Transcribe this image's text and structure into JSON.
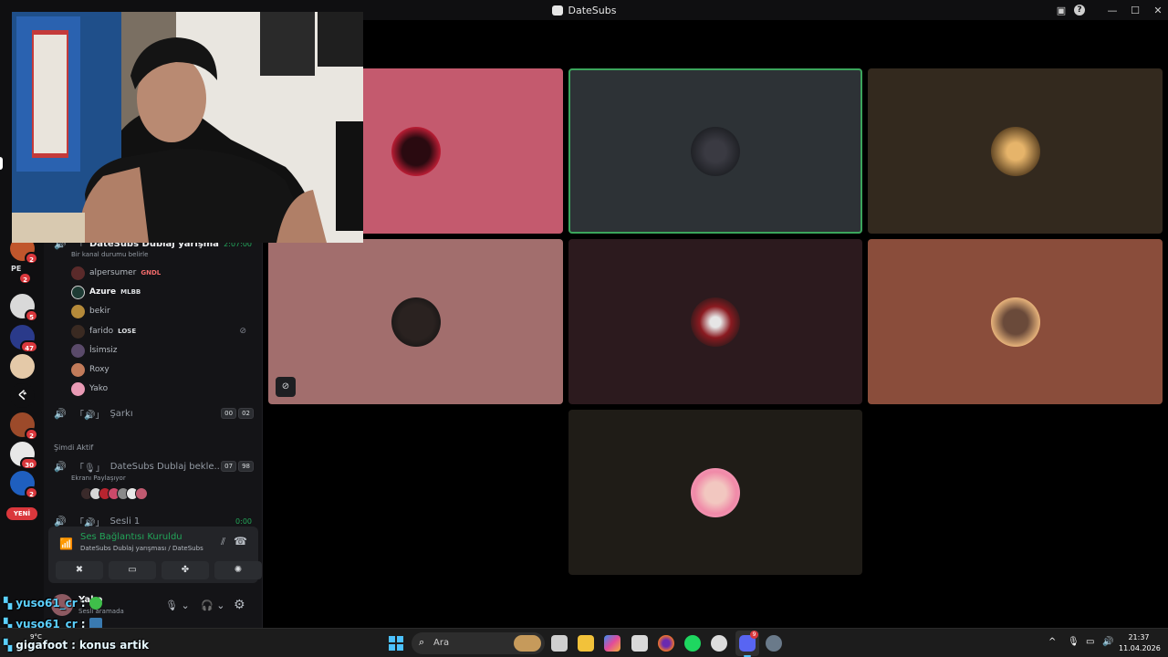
{
  "window": {
    "title": "DateSubs"
  },
  "rail": {
    "pe_label": "PE",
    "badges": [
      "2",
      "2",
      "5",
      "47",
      "2",
      "30",
      "2"
    ],
    "new_label": "YENİ"
  },
  "channels": {
    "top_voice": {
      "name": "DateSubs Dublaj yarışma",
      "timer": "2:07:00",
      "status_prompt": "Bir kanal durumu belirle"
    },
    "members": [
      {
        "name": "alpersumer",
        "tag": "GNDL"
      },
      {
        "name": "Azure",
        "tag": "MLBB"
      },
      {
        "name": "bekir",
        "tag": ""
      },
      {
        "name": "farido",
        "tag": "LOSE"
      },
      {
        "name": "İsimsiz",
        "tag": ""
      },
      {
        "name": "Roxy",
        "tag": ""
      },
      {
        "name": "Yako",
        "tag": ""
      }
    ],
    "sarki": {
      "name": "Şarkı",
      "count_a": "00",
      "count_b": "02"
    },
    "section_active": "Şimdi Aktif",
    "dublaj_bekle": {
      "name": "DateSubs Dublaj bekle...",
      "count_a": "07",
      "count_b": "98",
      "status": "Ekranı Paylaşıyor"
    },
    "sesli1": {
      "name": "Sesli 1",
      "timer": "0:00"
    }
  },
  "voice_panel": {
    "status": "Ses Bağlantısı Kuruldu",
    "channel": "DateSubs Dublaj yarışması / DateSubs"
  },
  "user_bar": {
    "name": "Yako",
    "status": "Sesli aramada"
  },
  "chat": [
    {
      "user": "yuso61_cr",
      "sep": ":",
      "message": ""
    },
    {
      "user": "yuso61_cr",
      "sep": ":",
      "message": ""
    },
    {
      "user": "gigafoot",
      "sep": ":",
      "message": "konus artik"
    }
  ],
  "taskbar": {
    "weather": "9°C",
    "search_placeholder": "Ara",
    "time": "21:37",
    "date": "11.04.2026",
    "discord_badge": "9"
  },
  "colors": {
    "accent_green": "#23a559",
    "discord_red": "#da373c",
    "speaking_outline": "#3ba55c"
  }
}
